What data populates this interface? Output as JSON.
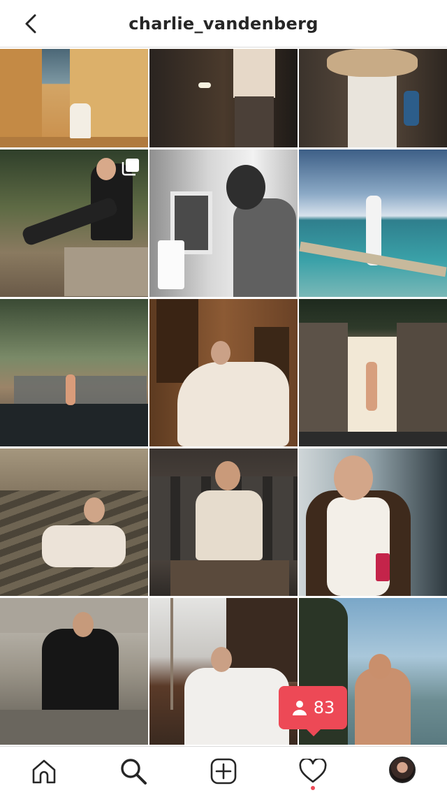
{
  "header": {
    "title": "charlie_vandenberg",
    "back_icon": "chevron-left-icon"
  },
  "notification": {
    "icon": "person-icon",
    "count": "83",
    "color": "#ed4956"
  },
  "bottom_nav": {
    "items": [
      "home-icon",
      "search-icon",
      "add-post-icon",
      "activity-heart-icon",
      "profile-avatar"
    ],
    "activity_dot_color": "#ed4956"
  }
}
